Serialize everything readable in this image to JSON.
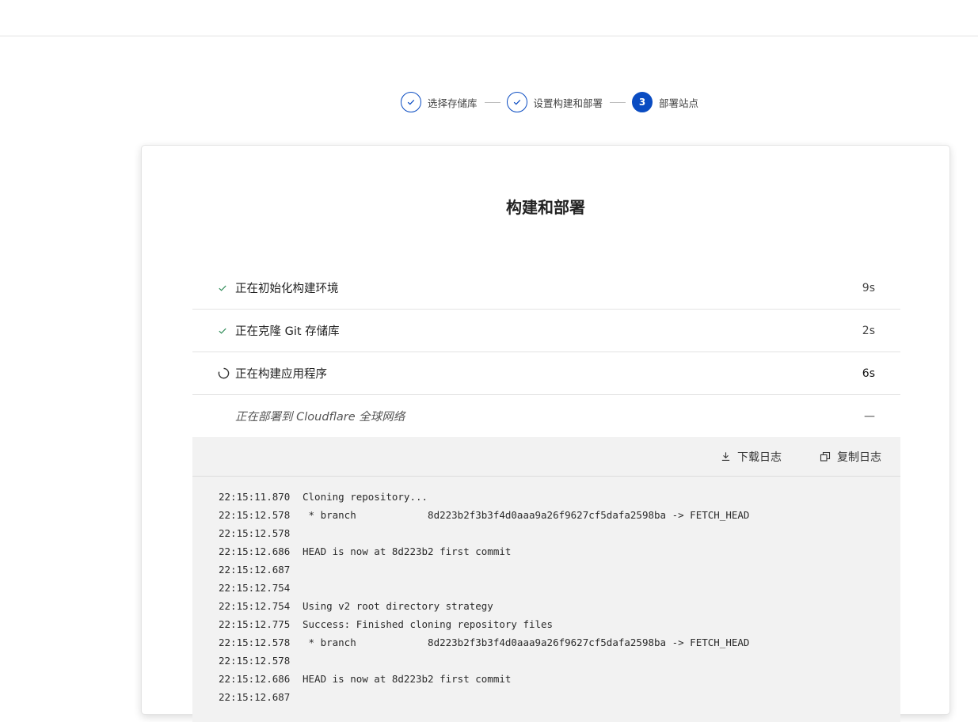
{
  "stepper": {
    "steps": [
      {
        "label": "选择存储库",
        "state": "done"
      },
      {
        "label": "设置构建和部署",
        "state": "done"
      },
      {
        "label": "部署站点",
        "state": "active",
        "number": "3"
      }
    ]
  },
  "card": {
    "title": "构建和部署",
    "steps": [
      {
        "label": "正在初始化构建环境",
        "time": "9s",
        "status": "done"
      },
      {
        "label": "正在克隆 Git 存储库",
        "time": "2s",
        "status": "done"
      },
      {
        "label": "正在构建应用程序",
        "time": "6s",
        "status": "in-progress"
      },
      {
        "label": "正在部署到 Cloudflare 全球网络",
        "time": "—",
        "status": "pending"
      }
    ]
  },
  "log": {
    "download_label": "下载日志",
    "copy_label": "复制日志",
    "lines": [
      {
        "ts": "22:15:11.870",
        "msg": "Cloning repository..."
      },
      {
        "ts": "22:15:12.578",
        "msg": " * branch            8d223b2f3b3f4d0aaa9a26f9627cf5dafa2598ba -> FETCH_HEAD"
      },
      {
        "ts": "22:15:12.578",
        "msg": ""
      },
      {
        "ts": "22:15:12.686",
        "msg": "HEAD is now at 8d223b2 first commit"
      },
      {
        "ts": "22:15:12.687",
        "msg": ""
      },
      {
        "ts": "22:15:12.754",
        "msg": ""
      },
      {
        "ts": "22:15:12.754",
        "msg": "Using v2 root directory strategy"
      },
      {
        "ts": "22:15:12.775",
        "msg": "Success: Finished cloning repository files"
      },
      {
        "ts": "22:15:12.578",
        "msg": " * branch            8d223b2f3b3f4d0aaa9a26f9627cf5dafa2598ba -> FETCH_HEAD"
      },
      {
        "ts": "22:15:12.578",
        "msg": ""
      },
      {
        "ts": "22:15:12.686",
        "msg": "HEAD is now at 8d223b2 first commit"
      },
      {
        "ts": "22:15:12.687",
        "msg": ""
      }
    ]
  },
  "colors": {
    "accent": "#0a4cc2",
    "success": "#2e8b57",
    "panel": "#f2f2f2"
  },
  "icons": {
    "done": "check-icon",
    "in-progress": "spinner-icon",
    "download": "download-icon",
    "copy": "copy-icon"
  }
}
